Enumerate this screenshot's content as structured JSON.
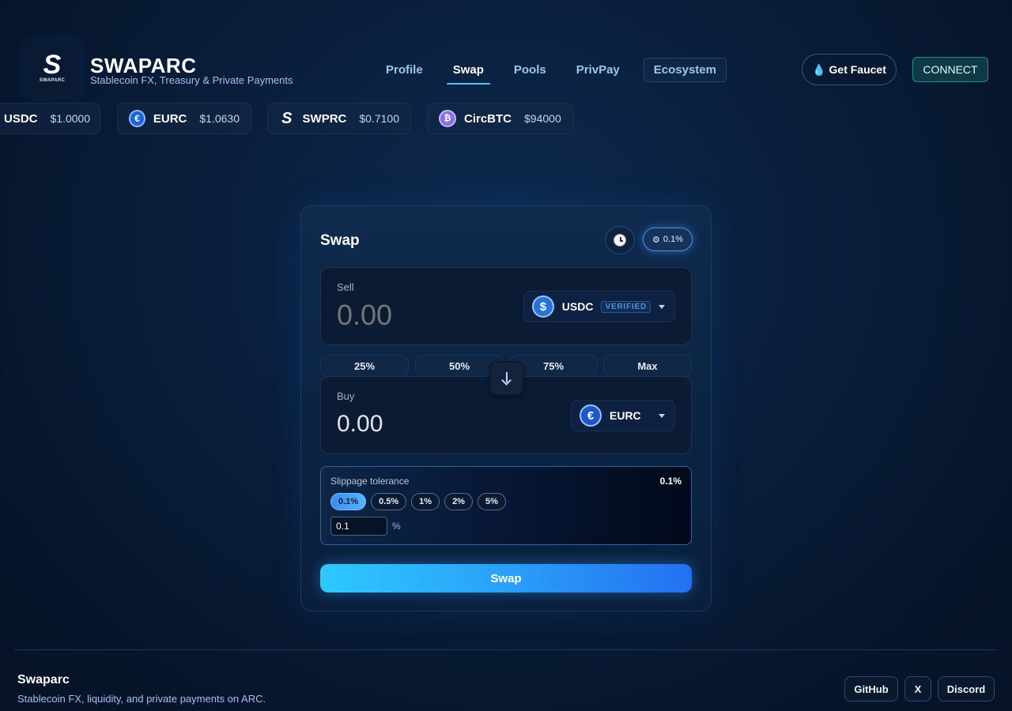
{
  "brand": {
    "logo_letter": "S",
    "logo_word": "SWAPARC",
    "name": "SWAPARC",
    "tagline": "Stablecoin FX, Treasury & Private Payments"
  },
  "nav": {
    "items": [
      {
        "label": "Profile",
        "active": false
      },
      {
        "label": "Swap",
        "active": true
      },
      {
        "label": "Pools",
        "active": false
      },
      {
        "label": "PrivPay",
        "active": false
      },
      {
        "label": "Ecosystem",
        "active": false
      }
    ]
  },
  "header": {
    "faucet_label": "Get Faucet",
    "faucet_icon": "droplet-icon",
    "connect_label": "CONNECT"
  },
  "ticker": [
    {
      "symbol": "USDC",
      "price": "$1.0000",
      "icon": "usdc-icon"
    },
    {
      "symbol": "EURC",
      "price": "$1.0630",
      "icon": "eurc-icon"
    },
    {
      "symbol": "SWPRC",
      "price": "$0.7100",
      "icon": "swprc-icon"
    },
    {
      "symbol": "CircBTC",
      "price": "$94000",
      "icon": "bitcoin-icon"
    }
  ],
  "swap": {
    "title": "Swap",
    "slippage_badge": "0.1%",
    "sell": {
      "label": "Sell",
      "placeholder": "0.00",
      "token": "USDC",
      "badge": "VERIFIED"
    },
    "percent_buttons": [
      "25%",
      "50%",
      "75%",
      "Max"
    ],
    "buy": {
      "label": "Buy",
      "value": "0.00",
      "token": "EURC"
    },
    "slippage": {
      "title": "Slippage tolerance",
      "current": "0.1%",
      "options": [
        "0.1%",
        "0.5%",
        "1%",
        "2%",
        "5%"
      ],
      "selected": "0.1%",
      "input_value": "0.1",
      "unit": "%"
    },
    "submit_label": "Swap"
  },
  "footer": {
    "title": "Swaparc",
    "tagline": "Stablecoin FX, liquidity, and private payments on ARC.",
    "links": [
      "GitHub",
      "X",
      "Discord"
    ]
  },
  "colors": {
    "accent": "#2aa0f8",
    "background": "#0a1f3d",
    "connect": "#0d3a44"
  }
}
